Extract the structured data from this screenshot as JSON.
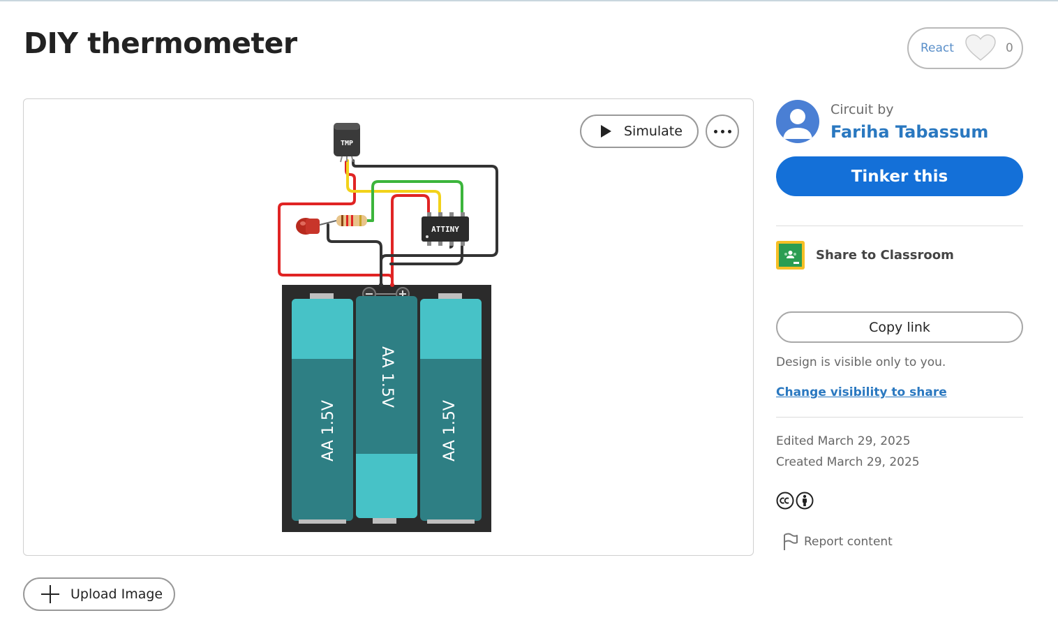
{
  "page": {
    "title": "DIY thermometer"
  },
  "react": {
    "label": "React",
    "count": "0"
  },
  "canvas": {
    "simulate_label": "Simulate",
    "circuit": {
      "sensor_label": "TMP",
      "chip_label": "ATTINY",
      "battery_labels": [
        "AA 1.5V",
        "AA 1.5V",
        "AA 1.5V"
      ]
    }
  },
  "upload": {
    "label": "Upload Image"
  },
  "author_block": {
    "circuit_by": "Circuit by",
    "author_name": "Fariha Tabassum"
  },
  "actions": {
    "tinker_label": "Tinker this",
    "classroom_label": "Share to Classroom",
    "copy_link_label": "Copy link"
  },
  "visibility": {
    "text": "Design is visible only to you.",
    "change_link": "Change visibility to share"
  },
  "dates": {
    "edited": "Edited March 29, 2025",
    "created": "Created March 29, 2025"
  },
  "license_icons": [
    "cc-icon",
    "attribution-icon"
  ],
  "report": {
    "label": "Report content"
  },
  "colors": {
    "accent": "#1470d8",
    "link": "#2a78c0",
    "battery_dark": "#2e7f84",
    "battery_light": "#47c2c7",
    "wire_red": "#e02424",
    "wire_black": "#333333",
    "wire_yellow": "#f2d21a",
    "wire_green": "#3cb53c"
  }
}
